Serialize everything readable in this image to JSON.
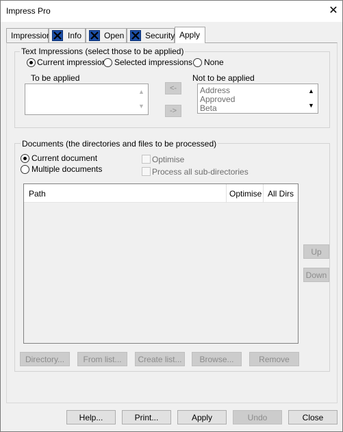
{
  "window": {
    "title": "Impress Pro",
    "close_glyph": "✕"
  },
  "tabs": [
    {
      "label": "Impression",
      "icon": null
    },
    {
      "label": "Info",
      "icon": "x-icon"
    },
    {
      "label": "Open",
      "icon": "x-icon"
    },
    {
      "label": "Security",
      "icon": "x-icon"
    },
    {
      "label": "Apply",
      "icon": null,
      "active": true
    }
  ],
  "text_impressions": {
    "legend": "Text Impressions (select those to be applied)",
    "radios": [
      {
        "label": "Current impression",
        "checked": true
      },
      {
        "label": "Selected impressions",
        "checked": false
      },
      {
        "label": "None",
        "checked": false
      }
    ],
    "to_be_applied_label": "To be applied",
    "not_to_be_applied_label": "Not to be applied",
    "move_left_label": "<-",
    "move_right_label": "->",
    "not_applied_items": [
      "Address",
      "Approved",
      "Beta"
    ]
  },
  "documents": {
    "legend": "Documents (the directories and files to be processed)",
    "radios": [
      {
        "label": "Current document",
        "checked": true
      },
      {
        "label": "Multiple documents",
        "checked": false
      }
    ],
    "checkboxes": [
      {
        "label": "Optimise",
        "checked": false
      },
      {
        "label": "Process all sub-directories",
        "checked": false
      }
    ],
    "columns": [
      "Path",
      "Optimise",
      "All Dirs"
    ],
    "up_label": "Up",
    "down_label": "Down",
    "actions": [
      "Directory...",
      "From list...",
      "Create list...",
      "Browse...",
      "Remove"
    ]
  },
  "footer": {
    "buttons": [
      "Help...",
      "Print...",
      "Apply",
      "Undo",
      "Close"
    ]
  },
  "colors": {
    "icon_blue": "#1c4ea6",
    "disabled_text": "#8c8c8c"
  }
}
